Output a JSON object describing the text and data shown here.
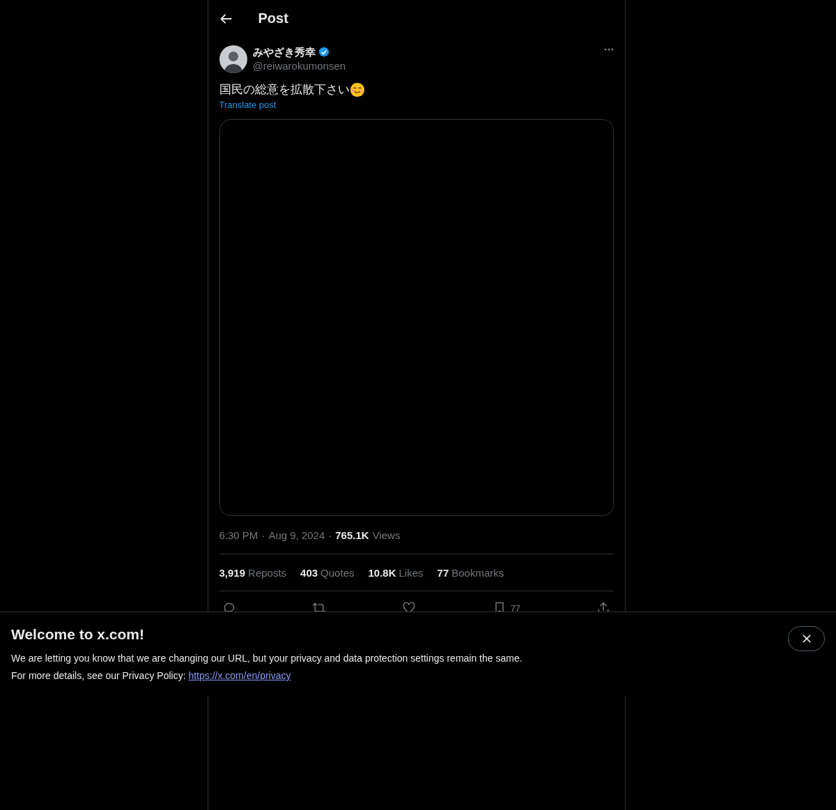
{
  "header": {
    "title": "Post"
  },
  "post": {
    "author": {
      "name": "みやざき秀幸",
      "handle": "@reiwarokumonsen",
      "verified": true
    },
    "text": "国民の総意を拡散下さい",
    "translate_label": "Translate post",
    "meta": {
      "time": "6:30 PM",
      "separator": "·",
      "date": "Aug 9, 2024",
      "views_count": "765.1K",
      "views_label": "Views"
    },
    "stats": [
      {
        "count": "3,919",
        "label": "Reposts"
      },
      {
        "count": "403",
        "label": "Quotes"
      },
      {
        "count": "10.8K",
        "label": "Likes"
      },
      {
        "count": "77",
        "label": "Bookmarks"
      }
    ],
    "actions": [
      {
        "kind": "reply"
      },
      {
        "kind": "repost"
      },
      {
        "kind": "like"
      },
      {
        "kind": "bookmark",
        "count": "77"
      },
      {
        "kind": "share"
      }
    ]
  },
  "banner": {
    "title": "Welcome to x.com!",
    "message": "We are letting you know that we are changing our URL, but your privacy and data protection settings remain the same.",
    "policy_prefix": "For more details, see our Privacy Policy:",
    "link": "https://x.com/en/privacy"
  }
}
